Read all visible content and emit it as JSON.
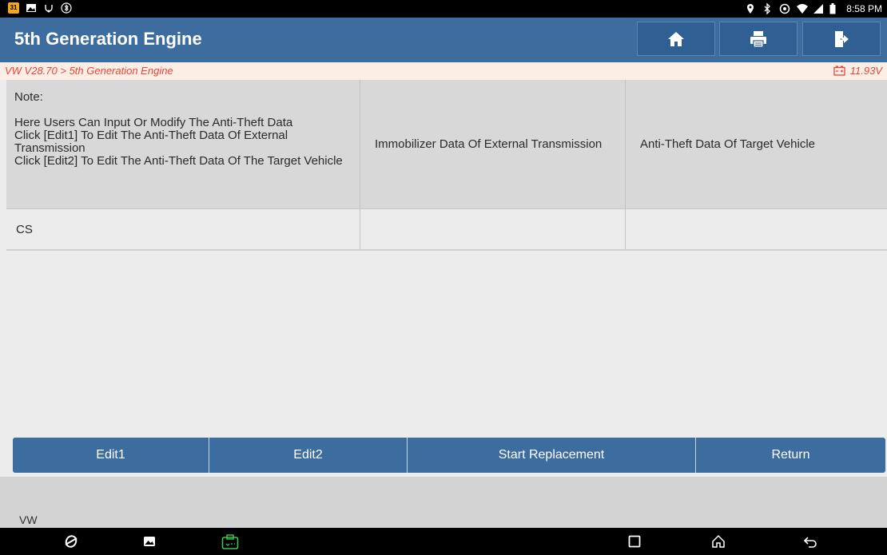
{
  "status_bar": {
    "time": "8:58 PM",
    "left_icons": [
      "calendar-icon",
      "image-icon",
      "usb-debug-icon",
      "bluetooth-icon"
    ],
    "right_icons": [
      "location-icon",
      "bluetooth-icon",
      "hotspot-icon",
      "wifi-icon",
      "signal-icon",
      "battery-icon"
    ],
    "calendar_badge": "31"
  },
  "header": {
    "title": "5th Generation Engine",
    "accent": "#3d6c9f",
    "buttons": [
      "home-icon",
      "printer-icon",
      "exit-icon"
    ]
  },
  "breadcrumb": {
    "path": "VW V28.70 > 5th Generation Engine",
    "voltage": "11.93V",
    "color": "#e8453c"
  },
  "table": {
    "header": {
      "note_title": "Note:",
      "note_lines": [
        "Here Users Can Input Or Modify The Anti-Theft Data",
        "Click [Edit1] To Edit The Anti-Theft Data Of External Transmission",
        "Click [Edit2] To Edit The Anti-Theft Data Of The Target Vehicle"
      ],
      "col2": "Immobilizer Data Of External Transmission",
      "col3": "Anti-Theft Data Of Target Vehicle"
    },
    "rows": [
      {
        "label": "CS",
        "external": "",
        "target": ""
      }
    ]
  },
  "actions": {
    "edit1": "Edit1",
    "edit2": "Edit2",
    "start": "Start Replacement",
    "return": "Return"
  },
  "footer": {
    "brand": "VW"
  },
  "nav_bar": [
    "browser-icon",
    "gallery-icon",
    "vci-icon",
    "recents-icon",
    "home-icon",
    "back-icon"
  ]
}
